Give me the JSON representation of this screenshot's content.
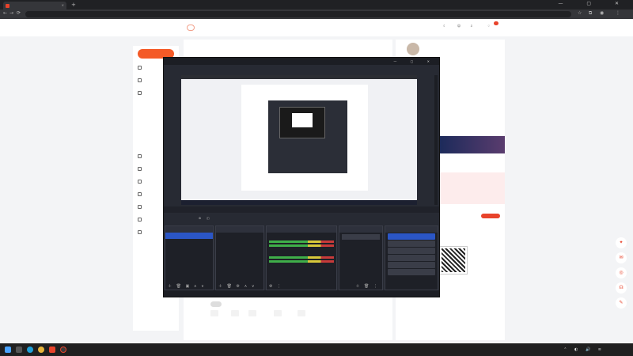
{
  "browser": {
    "tab_title": "",
    "url": "",
    "new_tab": "+",
    "close": "×",
    "window_controls": "— ▢ ✕",
    "nav": {
      "back": "←",
      "forward": "→",
      "reload": "⟳"
    },
    "toolbar_icons": [
      "star-icon",
      "extension-icon",
      "profile-icon",
      "menu-icon"
    ]
  },
  "header": {
    "logo_text": "",
    "version": "",
    "actions": [
      {
        "icon": "moon-icon",
        "label": ""
      },
      {
        "icon": "download-icon",
        "label": ""
      },
      {
        "icon": "notification-icon",
        "label": ""
      }
    ],
    "notification_count": ""
  },
  "sidebar": {
    "live_button": "",
    "items": [
      {
        "label": "",
        "type": "item"
      },
      {
        "label": "",
        "type": "item"
      },
      {
        "label": "",
        "type": "item"
      },
      {
        "label": "",
        "type": "sub"
      },
      {
        "label": "",
        "type": "sub"
      },
      {
        "label": "",
        "type": "sub"
      },
      {
        "label": "",
        "type": "sub"
      },
      {
        "label": "",
        "type": "item"
      },
      {
        "label": "",
        "type": "item"
      },
      {
        "label": "",
        "type": "item"
      },
      {
        "label": "",
        "type": "item"
      },
      {
        "label": "",
        "type": "item"
      },
      {
        "label": "",
        "type": "item"
      },
      {
        "label": "",
        "type": "item"
      }
    ]
  },
  "main": {
    "tabs": [
      "",
      ""
    ],
    "notice": "",
    "notice_link": "",
    "toggle_label": "",
    "tags_label": "",
    "tags": [
      "",
      "",
      "",
      "",
      ""
    ],
    "more": "",
    "footnote": ""
  },
  "right": {
    "name": "",
    "id_text": "",
    "banner_text": "",
    "greeting": "",
    "qr_caption": "",
    "float_icons": [
      "gift-icon",
      "message-icon",
      "target-icon",
      "headset-icon",
      "feedback-icon"
    ]
  },
  "obs": {
    "title": "",
    "menu": [
      "",
      "",
      "",
      "",
      "",
      "",
      ""
    ],
    "source_bar": "",
    "toolbar_items": [
      "",
      "",
      ""
    ],
    "panels": {
      "scenes": {
        "title": "",
        "items": [
          ""
        ]
      },
      "sources": {
        "title": "",
        "items": [
          "",
          "",
          ""
        ]
      },
      "mixer": {
        "title": "",
        "channels": [
          "",
          ""
        ],
        "levels": [
          "",
          ""
        ]
      },
      "transitions": {
        "title": "",
        "type": "",
        "duration_label": "",
        "duration": ""
      },
      "controls": {
        "title": "",
        "buttons": [
          "",
          "",
          "",
          "",
          "",
          ""
        ]
      }
    },
    "status": ""
  },
  "taskbar": {
    "time": "",
    "date": "",
    "apps": [
      "windows-icon",
      "search-icon",
      "edge-icon",
      "chrome-icon",
      "douyin-icon",
      "obs-icon"
    ],
    "tray": "⌃ ◐ 🔊 ≋"
  }
}
